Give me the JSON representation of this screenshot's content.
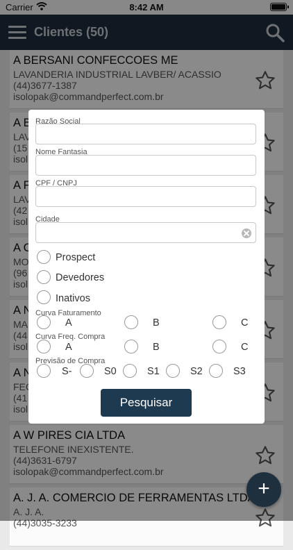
{
  "status_bar": {
    "carrier": "Carrier",
    "time": "8:42 AM"
  },
  "header": {
    "title": "Clientes (50)"
  },
  "clients": [
    {
      "name": "A BERSANI CONFECCOES ME",
      "fantasia": "LAVANDERIA INDUSTRIAL LAVBER/ ACASSIO",
      "phone": "(44)3677-1387",
      "email": "isolopak@commandperfect.com.br"
    },
    {
      "name": "A B",
      "fantasia": "LAV",
      "phone": "(15",
      "email": "isol"
    },
    {
      "name": "A F",
      "fantasia": "LAV",
      "phone": "(42",
      "email": "isol"
    },
    {
      "name": "A C",
      "fantasia": "MO",
      "phone": "(96",
      "email": "isol"
    },
    {
      "name": "A N",
      "fantasia": "MA",
      "phone": "(44",
      "email": "isol"
    },
    {
      "name": "A N",
      "fantasia": "FEC",
      "phone": "(41",
      "email": "isol"
    },
    {
      "name": "A W PIRES  CIA LTDA",
      "fantasia": "TELEFONE INEXISTENTE.",
      "phone": "(44)3631-6797",
      "email": "isolopak@commandperfect.com.br"
    },
    {
      "name": "A. J. A. COMERCIO DE FERRAMENTAS LTDA",
      "fantasia": "A. J. A.",
      "phone": "(44)3035-3233",
      "email": ""
    }
  ],
  "filter": {
    "razao_label": "Razão Social",
    "fantasia_label": "Nome Fantasia",
    "cpf_label": "CPF / CNPJ",
    "cidade_label": "Cidade",
    "options": [
      "Prospect",
      "Devedores",
      "Inativos"
    ],
    "curva_fat_label": "Curva Faturamento",
    "curva_freq_label": "Curva Freq. Compra",
    "previsao_label": "Previsão de Compra",
    "abc": [
      "A",
      "B",
      "C"
    ],
    "previsao": [
      "S-",
      "S0",
      "S1",
      "S2",
      "S3"
    ],
    "search_button": "Pesquisar"
  },
  "fab_icon": "plus-icon"
}
